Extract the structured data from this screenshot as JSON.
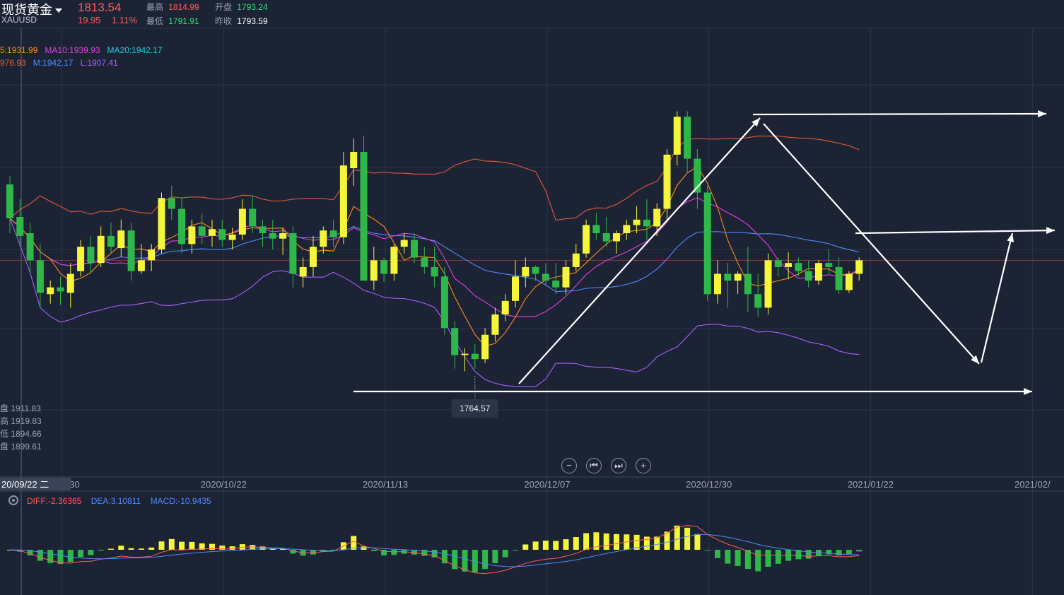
{
  "header": {
    "title": "现货黄金",
    "symbol": "XAUUSD",
    "price": "1813.54",
    "change": "19.95",
    "change_pct": "1.11%",
    "high_label": "最高",
    "high": "1814.99",
    "low_label": "最低",
    "low": "1791.91",
    "open_label": "开盘",
    "open": "1793.24",
    "prevclose_label": "昨收",
    "prevclose": "1793.59"
  },
  "legend": {
    "ma5": "5:1931.99",
    "ma10": "MA10:1939.93",
    "ma20": "MA20:1942.17",
    "boll_u": "976.93",
    "boll_m": "M:1942.17",
    "boll_l": "L:1907.41",
    "colors": {
      "ma5": "#ff8c1a",
      "ma10": "#e040e0",
      "ma20": "#1ecbe1",
      "boll_u": "#e05a3a",
      "boll_m": "#4a8cff",
      "boll_l": "#a560ff"
    }
  },
  "ohlc_panel": [
    "盘 1911.83",
    "高 1919.83",
    "低 1894.66",
    "盘 1899.61"
  ],
  "crosshair_date": "20/09/22 二",
  "low_marker": "1764.57",
  "macd_legend": {
    "diff": "DIFF:-2.36365",
    "dea": "DEA:3.10811",
    "macd": "MACD:-10.9435"
  },
  "controls": [
    "zoom-out",
    "prev",
    "next",
    "zoom-in"
  ],
  "chart_data": {
    "type": "candlestick",
    "ylim": [
      1750,
      1990
    ],
    "x_ticks": [
      "20/09/30",
      "2020/10/22",
      "2020/11/13",
      "2020/12/07",
      "2020/12/30",
      "2021/01/22",
      "2021/02/"
    ],
    "tick_candle_index": [
      5,
      21,
      37,
      53,
      69,
      85,
      101
    ],
    "candles": [
      [
        1906,
        1912,
        1870,
        1881
      ],
      [
        1882,
        1895,
        1860,
        1868
      ],
      [
        1870,
        1878,
        1840,
        1850
      ],
      [
        1850,
        1862,
        1815,
        1826
      ],
      [
        1825,
        1835,
        1818,
        1830
      ],
      [
        1830,
        1838,
        1817,
        1827
      ],
      [
        1826,
        1848,
        1815,
        1840
      ],
      [
        1842,
        1865,
        1838,
        1860
      ],
      [
        1860,
        1868,
        1840,
        1848
      ],
      [
        1848,
        1875,
        1845,
        1868
      ],
      [
        1868,
        1878,
        1855,
        1860
      ],
      [
        1859,
        1880,
        1852,
        1872
      ],
      [
        1872,
        1878,
        1835,
        1842
      ],
      [
        1842,
        1862,
        1840,
        1850
      ],
      [
        1850,
        1862,
        1842,
        1858
      ],
      [
        1858,
        1900,
        1855,
        1896
      ],
      [
        1896,
        1905,
        1880,
        1888
      ],
      [
        1888,
        1896,
        1855,
        1862
      ],
      [
        1862,
        1880,
        1855,
        1875
      ],
      [
        1875,
        1885,
        1862,
        1868
      ],
      [
        1868,
        1880,
        1860,
        1873
      ],
      [
        1873,
        1880,
        1860,
        1865
      ],
      [
        1865,
        1874,
        1858,
        1869
      ],
      [
        1869,
        1895,
        1865,
        1888
      ],
      [
        1888,
        1898,
        1870,
        1875
      ],
      [
        1875,
        1880,
        1860,
        1870
      ],
      [
        1870,
        1880,
        1858,
        1866
      ],
      [
        1866,
        1874,
        1854,
        1870
      ],
      [
        1870,
        1875,
        1830,
        1840
      ],
      [
        1838,
        1852,
        1830,
        1845
      ],
      [
        1845,
        1868,
        1838,
        1860
      ],
      [
        1860,
        1875,
        1855,
        1872
      ],
      [
        1872,
        1880,
        1860,
        1867
      ],
      [
        1867,
        1930,
        1862,
        1920
      ],
      [
        1918,
        1940,
        1905,
        1930
      ],
      [
        1930,
        1942,
        1835,
        1835
      ],
      [
        1835,
        1860,
        1828,
        1850
      ],
      [
        1850,
        1852,
        1834,
        1840
      ],
      [
        1840,
        1862,
        1835,
        1860
      ],
      [
        1860,
        1870,
        1855,
        1865
      ],
      [
        1865,
        1870,
        1848,
        1852
      ],
      [
        1852,
        1860,
        1840,
        1845
      ],
      [
        1845,
        1860,
        1830,
        1838
      ],
      [
        1838,
        1845,
        1795,
        1800
      ],
      [
        1800,
        1805,
        1770,
        1780
      ],
      [
        1780,
        1785,
        1768,
        1781
      ],
      [
        1781,
        1788,
        1770,
        1777
      ],
      [
        1777,
        1800,
        1774,
        1795
      ],
      [
        1795,
        1815,
        1790,
        1810
      ],
      [
        1810,
        1825,
        1805,
        1820
      ],
      [
        1820,
        1850,
        1815,
        1838
      ],
      [
        1838,
        1852,
        1830,
        1845
      ],
      [
        1845,
        1846,
        1835,
        1840
      ],
      [
        1840,
        1848,
        1832,
        1835
      ],
      [
        1835,
        1848,
        1825,
        1830
      ],
      [
        1830,
        1850,
        1825,
        1845
      ],
      [
        1845,
        1862,
        1842,
        1855
      ],
      [
        1855,
        1880,
        1852,
        1876
      ],
      [
        1876,
        1885,
        1865,
        1870
      ],
      [
        1870,
        1882,
        1860,
        1864
      ],
      [
        1864,
        1872,
        1855,
        1870
      ],
      [
        1870,
        1880,
        1865,
        1876
      ],
      [
        1876,
        1890,
        1870,
        1880
      ],
      [
        1880,
        1895,
        1865,
        1875
      ],
      [
        1875,
        1892,
        1868,
        1888
      ],
      [
        1888,
        1932,
        1880,
        1928
      ],
      [
        1928,
        1960,
        1920,
        1956
      ],
      [
        1956,
        1960,
        1915,
        1925
      ],
      [
        1925,
        1932,
        1888,
        1900
      ],
      [
        1900,
        1905,
        1820,
        1825
      ],
      [
        1825,
        1850,
        1818,
        1840
      ],
      [
        1840,
        1848,
        1815,
        1835
      ],
      [
        1835,
        1842,
        1825,
        1840
      ],
      [
        1840,
        1860,
        1812,
        1825
      ],
      [
        1825,
        1840,
        1808,
        1815
      ],
      [
        1815,
        1855,
        1810,
        1850
      ],
      [
        1850,
        1852,
        1838,
        1845
      ],
      [
        1845,
        1856,
        1836,
        1848
      ],
      [
        1848,
        1852,
        1838,
        1842
      ],
      [
        1842,
        1850,
        1830,
        1835
      ],
      [
        1835,
        1850,
        1832,
        1848
      ],
      [
        1848,
        1858,
        1840,
        1845
      ],
      [
        1845,
        1852,
        1825,
        1828
      ],
      [
        1828,
        1842,
        1826,
        1840
      ],
      [
        1840,
        1852,
        1835,
        1850
      ]
    ],
    "annotations": {
      "low_price": 1764.57,
      "low_index": 46
    }
  }
}
